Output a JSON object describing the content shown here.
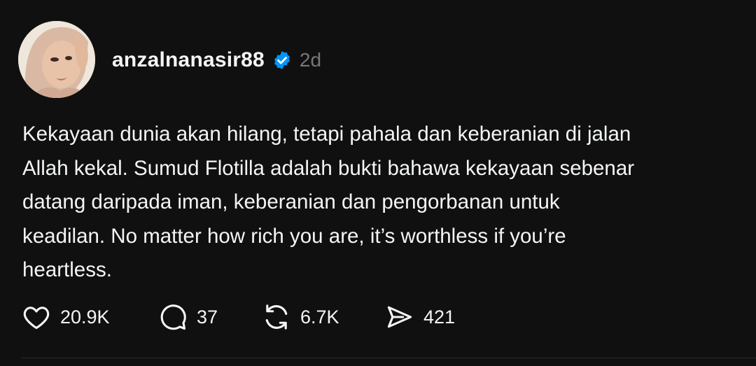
{
  "post": {
    "username": "anzalnanasir88",
    "timestamp": "2d",
    "text_lines": [
      "Kekayaan dunia akan hilang, tetapi pahala dan keberanian di jalan",
      "Allah kekal. Sumud Flotilla adalah bukti bahawa kekayaan sebenar",
      "datang daripada iman, keberanian dan pengorbanan untuk",
      "keadilan. No matter how rich you are, it’s worthless if you’re",
      "heartless."
    ],
    "actions": {
      "likes": "20.9K",
      "replies": "37",
      "reposts": "6.7K",
      "shares": "421"
    }
  },
  "colors": {
    "background": "#101010",
    "text": "#f3f5f7",
    "muted": "#777777",
    "verified": "#0095f6"
  },
  "icons": [
    "avatar",
    "verified-badge-icon",
    "heart-icon",
    "comment-icon",
    "repost-icon",
    "share-icon"
  ]
}
